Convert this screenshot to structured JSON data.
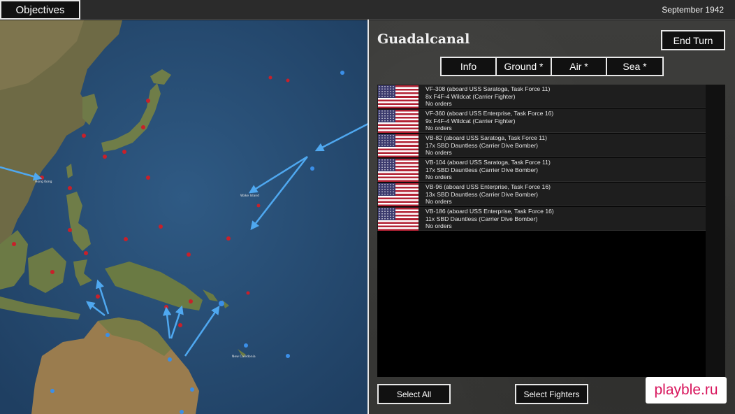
{
  "topbar": {
    "objectives_label": "Objectives",
    "date": "September 1942"
  },
  "panel": {
    "region_title": "Guadalcanal",
    "end_turn_label": "End Turn",
    "tabs": [
      {
        "label": "Info"
      },
      {
        "label": "Ground *"
      },
      {
        "label": "Air *"
      },
      {
        "label": "Sea *"
      }
    ],
    "units": [
      {
        "name": "VF-308 (aboard USS Saratoga, Task Force 11)",
        "aircraft": "8x F4F-4 Wildcat (Carrier Fighter)",
        "orders": "No orders"
      },
      {
        "name": "VF-360 (aboard USS Enterprise, Task Force 16)",
        "aircraft": "9x F4F-4 Wildcat (Carrier Fighter)",
        "orders": "No orders"
      },
      {
        "name": "VB-82 (aboard USS Saratoga, Task Force 11)",
        "aircraft": "17x SBD Dauntless (Carrier Dive Bomber)",
        "orders": "No orders"
      },
      {
        "name": "VB-104 (aboard USS Saratoga, Task Force 11)",
        "aircraft": "17x SBD Dauntless (Carrier Dive Bomber)",
        "orders": "No orders"
      },
      {
        "name": "VB-96 (aboard USS Enterprise, Task Force 16)",
        "aircraft": "13x SBD Dauntless (Carrier Dive Bomber)",
        "orders": "No orders"
      },
      {
        "name": "VB-186 (aboard USS Enterprise, Task Force 16)",
        "aircraft": "11x SBD Dauntless (Carrier Dive Bomber)",
        "orders": "No orders"
      }
    ],
    "select_all_label": "Select All",
    "select_fighters_label": "Select Fighters"
  },
  "map": {
    "labels": {
      "hong_kong": "Hong Kong",
      "wake_island": "Wake Island",
      "new_caledonia": "New Caledonia"
    }
  },
  "watermark": "playble.ru",
  "colors": {
    "ocean": "#2a4d73",
    "land": "#7a6f48",
    "arrow": "#4fa8f0",
    "japan_marker": "#c8202a",
    "us_marker": "#3b8fe8"
  }
}
